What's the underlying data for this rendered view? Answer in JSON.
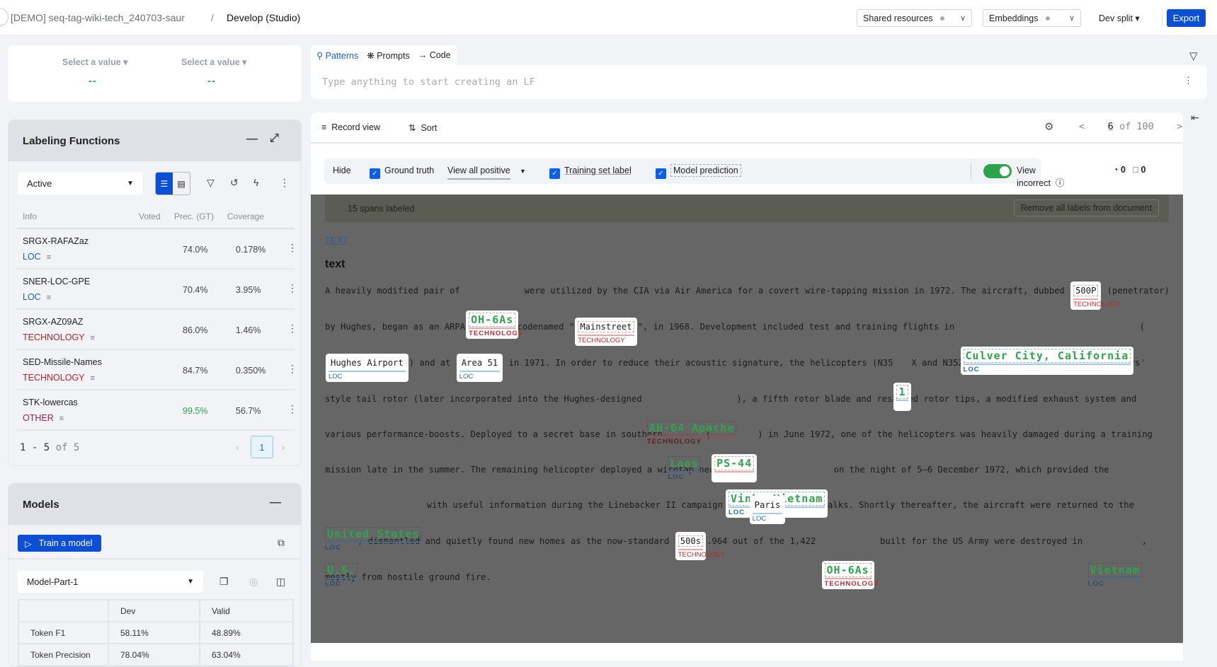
{
  "header": {
    "project": "[DEMO] seq-tag-wiki-tech_240703-saur",
    "separator": "/",
    "page": "Develop (Studio)",
    "shared_resources": "Shared resources",
    "embeddings": "Embeddings",
    "split": "Dev split",
    "export": "Export"
  },
  "selectors": [
    {
      "label": "Select a value",
      "value": "--"
    },
    {
      "label": "Select a value",
      "value": "--"
    }
  ],
  "lf_panel": {
    "title": "Labeling Functions",
    "filter_value": "Active",
    "columns": [
      "Info",
      "Voted",
      "Prec. (GT)",
      "Coverage"
    ],
    "rows": [
      {
        "name": "SRGX-RAFAZaz",
        "label": "LOC",
        "label_color": "#1d5fa8",
        "prec": "74.0%",
        "prec_color": "#444444",
        "coverage": "0.178%"
      },
      {
        "name": "SNER-LOC-GPE",
        "label": "LOC",
        "label_color": "#1d5fa8",
        "prec": "70.4%",
        "prec_color": "#444444",
        "coverage": "3.95%"
      },
      {
        "name": "SRGX-AZ09AZ",
        "label": "TECHNOLOGY",
        "label_color": "#b3232b",
        "prec": "86.0%",
        "prec_color": "#444444",
        "coverage": "1.46%"
      },
      {
        "name": "SED-Missile-Names",
        "label": "TECHNOLOGY",
        "label_color": "#b3232b",
        "prec": "84.7%",
        "prec_color": "#444444",
        "coverage": "0.350%"
      },
      {
        "name": "STK-lowercas",
        "label": "OTHER",
        "label_color": "#a3205a",
        "prec": "99.5%",
        "prec_color": "#2fa44f",
        "coverage": "56.7%"
      }
    ],
    "pager": {
      "range": "1 - 5",
      "of": "of 5",
      "current": "1"
    }
  },
  "models_panel": {
    "title": "Models",
    "train_button": "Train a model",
    "model_select": "Model-Part-1",
    "table": {
      "columns": [
        "",
        "Dev",
        "Valid"
      ],
      "rows": [
        [
          "Token F1",
          "58.11%",
          "48.89%"
        ],
        [
          "Token Precision",
          "78.04%",
          "63.04%"
        ]
      ]
    }
  },
  "lf_builder": {
    "tabs": [
      "Patterns",
      "Prompts",
      "Code"
    ],
    "placeholder": "Type anything to start creating an LF"
  },
  "viewer": {
    "record_view": "Record view",
    "sort": "Sort",
    "record_current": "6",
    "record_total": "of 100",
    "options": {
      "hide": "Hide",
      "ground_truth": "Ground truth",
      "view_mode": "View all positive",
      "training_set_label": "Training set label",
      "model_prediction": "Model prediction",
      "view_incorrect": "View incorrect",
      "view_incorrect_on": true,
      "count_a": "0",
      "count_b": "0"
    },
    "spans_labeled": "15 spans labeled",
    "remove_all": "Remove all labels from document",
    "field_link": "TEXT",
    "field_name": "text",
    "document": [
      {
        "t": "A heavily modified pair of "
      },
      {
        "s": "OH-6As",
        "label": "TECHNOLOGY",
        "kind": "tech",
        "hl": true
      },
      {
        "t": " were utilized by the CIA via Air America for a covert wire-tapping mission in 1972. The aircraft, dubbed "
      },
      {
        "s": "500P",
        "label": "TECHNOLOGY",
        "kind": "tech",
        "hl": true,
        "nobox": true
      },
      {
        "t": " (penetrator) by Hughes, began as an ARPA project, codenamed \""
      },
      {
        "s": "Mainstreet",
        "label": "TECHNOLOGY",
        "kind": "tech",
        "hl": true,
        "nobox": true
      },
      {
        "t": "\", in 1968.  Development included test and training flights in "
      },
      {
        "s": "Culver City, California",
        "label": "LOC",
        "kind": "loc",
        "hl": true
      },
      {
        "t": " ("
      },
      {
        "s": "Hughes Airport",
        "label": "LOC",
        "kind": "loc",
        "hl": true,
        "nobox": true
      },
      {
        "t": ") and at "
      },
      {
        "s": "Area 51",
        "label": "LOC",
        "kind": "loc",
        "hl": true,
        "nobox": true
      },
      {
        "t": " in 1971. In order to reduce their acoustic signature, the helicopters (N35"
      },
      {
        "s": "1",
        "label": "",
        "kind": "loc",
        "hl": true
      },
      {
        "t": "X and N352X) received a four-blade 'scissors' style tail rotor (later incorporated into the Hughes-designed "
      },
      {
        "s": "AH-64 Apache",
        "label": "TECHNOLOGY",
        "kind": "tech",
        "hl": false
      },
      {
        "t": "), a fifth rotor blade and reshaped rotor tips, a modified exhaust system and various performance-boosts.  Deployed to a secret base in southern "
      },
      {
        "s": "Laos",
        "label": "LOC",
        "kind": "loc",
        "hl": false
      },
      {
        "t": " ("
      },
      {
        "s": "PS-44",
        "label": "",
        "kind": "tech",
        "hl": true
      },
      {
        "t": ") in June 1972, one of the helicopters was heavily damaged during a training mission late in the summer.  The remaining helicopter deployed a wiretap near "
      },
      {
        "s": "Vinh, Vietnam",
        "label": "LOC",
        "kind": "loc",
        "hl": true
      },
      {
        "t": " on the night of 5–6 December 1972, which provided the "
      },
      {
        "s": "United States",
        "label": "LOC",
        "kind": "loc",
        "hl": false
      },
      {
        "t": " with useful information during the Linebacker II campaign and "
      },
      {
        "s": "Paris",
        "label": "LOC",
        "kind": "loc",
        "hl": true,
        "nobox": true
      },
      {
        "t": " Peace Talks. Shortly thereafter, the aircraft were returned to the "
      },
      {
        "s": "U.S.",
        "label": "LOC",
        "kind": "loc",
        "hl": false
      },
      {
        "t": ", dismantled and quietly found new homes as the now-standard "
      },
      {
        "s": "500s",
        "label": "TECHNOLOGY",
        "kind": "tech",
        "hl": true,
        "nobox": true
      },
      {
        "t": ".964 out of the 1,422 "
      },
      {
        "s": "OH-6As",
        "label": "TECHNOLOGY",
        "kind": "tech",
        "hl": true
      },
      {
        "t": " built for the US Army were destroyed in "
      },
      {
        "s": "Vietnam",
        "label": "LOC",
        "kind": "loc",
        "hl": false
      },
      {
        "t": ", mostly from hostile ground fire."
      }
    ]
  }
}
